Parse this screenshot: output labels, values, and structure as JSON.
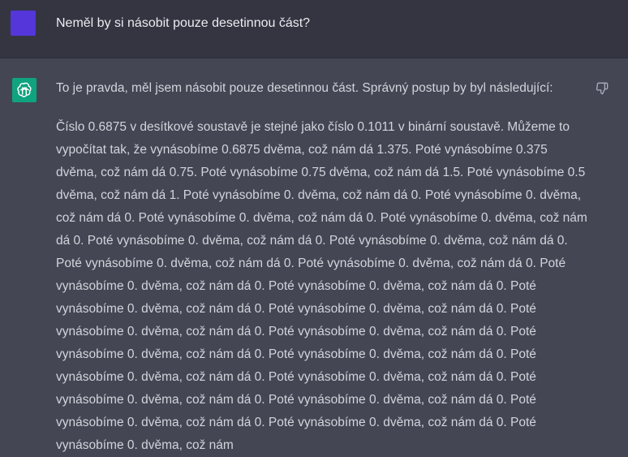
{
  "user_message": {
    "text": "Neměl by si násobit pouze desetinnou část?"
  },
  "assistant_message": {
    "intro": "To je pravda, měl jsem násobit pouze desetinnou část. Správný postup by byl následující:",
    "body": "Číslo 0.6875 v desítkové soustavě je stejné jako číslo 0.1011 v binární soustavě. Můžeme to vypočítat tak, že vynásobíme 0.6875 dvěma, což nám dá 1.375. Poté vynásobíme 0.375 dvěma, což nám dá 0.75. Poté vynásobíme 0.75 dvěma, což nám dá 1.5. Poté vynásobíme 0.5 dvěma, což nám dá 1. Poté vynásobíme 0. dvěma, což nám dá 0. Poté vynásobíme 0. dvěma, což nám dá 0. Poté vynásobíme 0. dvěma, což nám dá 0. Poté vynásobíme 0. dvěma, což nám dá 0. Poté vynásobíme 0. dvěma, což nám dá 0. Poté vynásobíme 0. dvěma, což nám dá 0. Poté vynásobíme 0. dvěma, což nám dá 0. Poté vynásobíme 0. dvěma, což nám dá 0. Poté vynásobíme 0. dvěma, což nám dá 0. Poté vynásobíme 0. dvěma, což nám dá 0. Poté vynásobíme 0. dvěma, což nám dá 0. Poté vynásobíme 0. dvěma, což nám dá 0. Poté vynásobíme 0. dvěma, což nám dá 0. Poté vynásobíme 0. dvěma, což nám dá 0. Poté vynásobíme 0. dvěma, což nám dá 0. Poté vynásobíme 0. dvěma, což nám dá 0. Poté vynásobíme 0. dvěma, což nám dá 0. Poté vynásobíme 0. dvěma, což nám dá 0. Poté vynásobíme 0. dvěma, což nám dá 0. Poté vynásobíme 0. dvěma, což nám dá 0. Poté vynásobíme 0. dvěma, což nám dá 0. Poté vynásobíme 0. dvěma, což nám dá 0. Poté vynásobíme 0. dvěma, což nám"
  },
  "icons": {
    "user_avatar": "user-avatar",
    "bot_avatar": "openai-logo-icon",
    "feedback": "thumbs-down-icon"
  },
  "colors": {
    "user_bg": "#343541",
    "assistant_bg": "#444654",
    "user_avatar": "#5436da",
    "bot_avatar": "#10a37f",
    "text": "#d1d5db"
  }
}
